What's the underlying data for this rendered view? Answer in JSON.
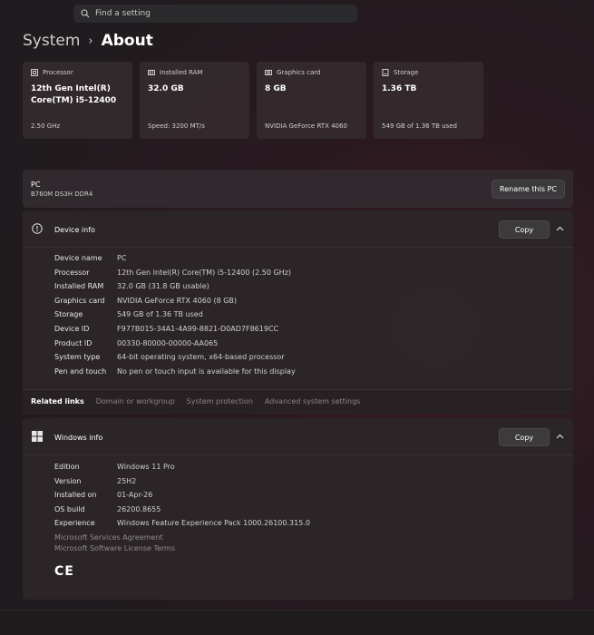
{
  "search": {
    "placeholder": "Find a setting",
    "icon": "search-icon"
  },
  "breadcrumb": {
    "parent": "System",
    "separator": "›",
    "current": "About"
  },
  "cards": [
    {
      "label": "Processor",
      "value": "12th Gen Intel(R) Core(TM) i5-12400",
      "sub": "2.50 GHz",
      "icon": "processor-icon"
    },
    {
      "label": "Installed RAM",
      "value": "32.0 GB",
      "sub": "Speed: 3200 MT/s",
      "icon": "ram-icon"
    },
    {
      "label": "Graphics card",
      "value": "8 GB",
      "sub": "NVIDIA GeForce RTX 4060",
      "icon": "graphics-card-icon"
    },
    {
      "label": "Storage",
      "value": "1.36 TB",
      "sub": "549 GB of 1.36 TB used",
      "icon": "storage-icon"
    }
  ],
  "pc": {
    "name": "PC",
    "model": "B760M DS3H DDR4",
    "rename_label": "Rename this PC"
  },
  "device_info": {
    "title": "Device info",
    "copy_label": "Copy",
    "rows": [
      {
        "key": "Device name",
        "value": "PC"
      },
      {
        "key": "Processor",
        "value": "12th Gen Intel(R) Core(TM) i5-12400 (2.50 GHz)"
      },
      {
        "key": "Installed RAM",
        "value": "32.0 GB (31.8 GB usable)"
      },
      {
        "key": "Graphics card",
        "value": "NVIDIA GeForce RTX 4060 (8 GB)"
      },
      {
        "key": "Storage",
        "value": "549 GB of 1.36 TB used"
      },
      {
        "key": "Device ID",
        "value": "F977B015-34A1-4A99-8821-D0AD7F8619CC"
      },
      {
        "key": "Product ID",
        "value": "00330-80000-00000-AA065"
      },
      {
        "key": "System type",
        "value": "64-bit operating system, x64-based processor"
      },
      {
        "key": "Pen and touch",
        "value": "No pen or touch input is available for this display"
      }
    ]
  },
  "related": {
    "label": "Related links",
    "links": [
      "Domain or workgroup",
      "System protection",
      "Advanced system settings"
    ]
  },
  "windows_info": {
    "title": "Windows info",
    "copy_label": "Copy",
    "rows": [
      {
        "key": "Edition",
        "value": "Windows 11 Pro"
      },
      {
        "key": "Version",
        "value": "25H2"
      },
      {
        "key": "Installed on",
        "value": "01-Apr-26"
      },
      {
        "key": "OS build",
        "value": "26200.8655"
      },
      {
        "key": "Experience",
        "value": "Windows Feature Experience Pack 1000.26100.315.0"
      }
    ],
    "services_agreement": "Microsoft Services Agreement",
    "license_terms": "Microsoft Software License Terms",
    "ce_mark": "CE"
  },
  "colors": {
    "accent_bg": "#2a1a20",
    "card_bg": "#342a2e",
    "button_bg": "#3c3a3c"
  }
}
